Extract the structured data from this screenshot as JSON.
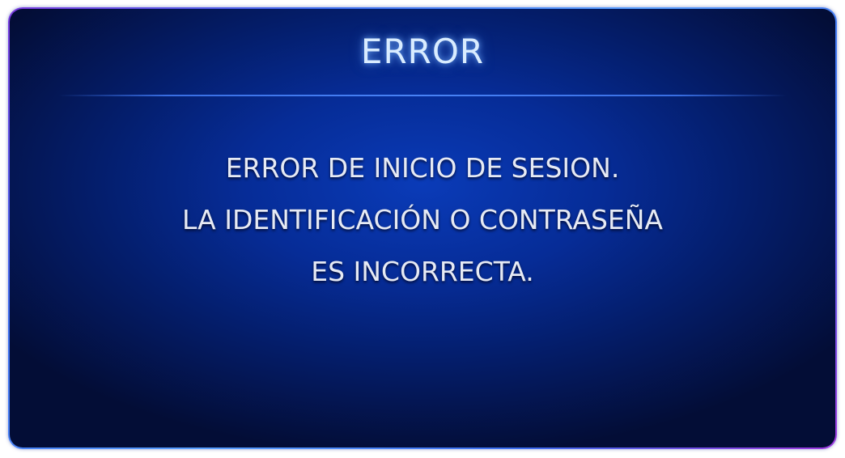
{
  "dialog": {
    "title": "ERROR",
    "message_lines": [
      "ERROR DE INICIO DE SESION.",
      "LA IDENTIFICACIÓN O CONTRASEÑA",
      "ES INCORRECTA."
    ]
  }
}
